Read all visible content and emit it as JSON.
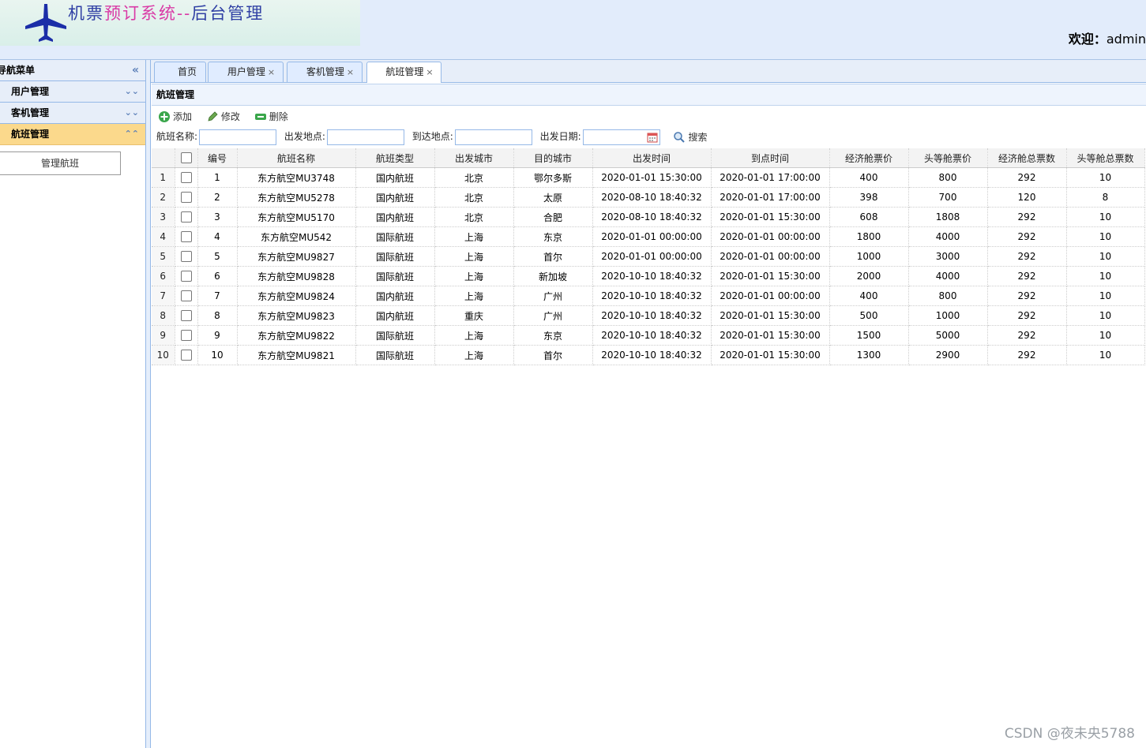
{
  "header": {
    "title_part1": "机票",
    "title_part2": "预订系统--",
    "title_part3": "后台管理",
    "welcome_label": "欢迎：",
    "welcome_user": "admin"
  },
  "sidebar": {
    "title": "导航菜单",
    "items": [
      {
        "label": "用户管理"
      },
      {
        "label": "客机管理"
      },
      {
        "label": "航班管理"
      }
    ],
    "sub_item": "管理航班"
  },
  "tabs": [
    {
      "label": "首页"
    },
    {
      "label": "用户管理"
    },
    {
      "label": "客机管理"
    },
    {
      "label": "航班管理"
    }
  ],
  "tab_close": "×",
  "panel": {
    "title": "航班管理"
  },
  "toolbar": {
    "add": "添加",
    "edit": "修改",
    "delete": "删除"
  },
  "search": {
    "name_label": "航班名称:",
    "from_label": "出发地点:",
    "to_label": "到达地点:",
    "date_label": "出发日期:",
    "button": "搜索"
  },
  "grid": {
    "columns": [
      "编号",
      "航班名称",
      "航班类型",
      "出发城市",
      "目的城市",
      "出发时间",
      "到点时间",
      "经济舱票价",
      "头等舱票价",
      "经济舱总票数",
      "头等舱总票数"
    ],
    "rows": [
      [
        "1",
        "1",
        "东方航空MU3748",
        "国内航班",
        "北京",
        "鄂尔多斯",
        "2020-01-01 15:30:00",
        "2020-01-01 17:00:00",
        "400",
        "800",
        "292",
        "10"
      ],
      [
        "2",
        "2",
        "东方航空MU5278",
        "国内航班",
        "北京",
        "太原",
        "2020-08-10 18:40:32",
        "2020-01-01 17:00:00",
        "398",
        "700",
        "120",
        "8"
      ],
      [
        "3",
        "3",
        "东方航空MU5170",
        "国内航班",
        "北京",
        "合肥",
        "2020-08-10 18:40:32",
        "2020-01-01 15:30:00",
        "608",
        "1808",
        "292",
        "10"
      ],
      [
        "4",
        "4",
        "东方航空MU542",
        "国际航班",
        "上海",
        "东京",
        "2020-01-01 00:00:00",
        "2020-01-01 00:00:00",
        "1800",
        "4000",
        "292",
        "10"
      ],
      [
        "5",
        "5",
        "东方航空MU9827",
        "国际航班",
        "上海",
        "首尔",
        "2020-01-01 00:00:00",
        "2020-01-01 00:00:00",
        "1000",
        "3000",
        "292",
        "10"
      ],
      [
        "6",
        "6",
        "东方航空MU9828",
        "国际航班",
        "上海",
        "新加坡",
        "2020-10-10 18:40:32",
        "2020-01-01 15:30:00",
        "2000",
        "4000",
        "292",
        "10"
      ],
      [
        "7",
        "7",
        "东方航空MU9824",
        "国内航班",
        "上海",
        "广州",
        "2020-10-10 18:40:32",
        "2020-01-01 00:00:00",
        "400",
        "800",
        "292",
        "10"
      ],
      [
        "8",
        "8",
        "东方航空MU9823",
        "国内航班",
        "重庆",
        "广州",
        "2020-10-10 18:40:32",
        "2020-01-01 15:30:00",
        "500",
        "1000",
        "292",
        "10"
      ],
      [
        "9",
        "9",
        "东方航空MU9822",
        "国际航班",
        "上海",
        "东京",
        "2020-10-10 18:40:32",
        "2020-01-01 15:30:00",
        "1500",
        "5000",
        "292",
        "10"
      ],
      [
        "10",
        "10",
        "东方航空MU9821",
        "国际航班",
        "上海",
        "首尔",
        "2020-10-10 18:40:32",
        "2020-01-01 15:30:00",
        "1300",
        "2900",
        "292",
        "10"
      ]
    ]
  },
  "watermark": "CSDN @夜未央5788",
  "colors": {
    "header_bg": "#e2ecfb",
    "active_menu": "#fbd98c",
    "border": "#95b8e7",
    "title_blue": "#2f3fa4",
    "title_pink": "#d93aa6"
  },
  "icons": {
    "logo": "airplane-icon",
    "collapse": "double-chevron-left-icon",
    "expand": "double-chevron-down-icon",
    "add": "plus-icon",
    "edit": "pencil-icon",
    "delete": "minus-icon",
    "calendar": "calendar-icon",
    "search": "magnifier-icon"
  }
}
